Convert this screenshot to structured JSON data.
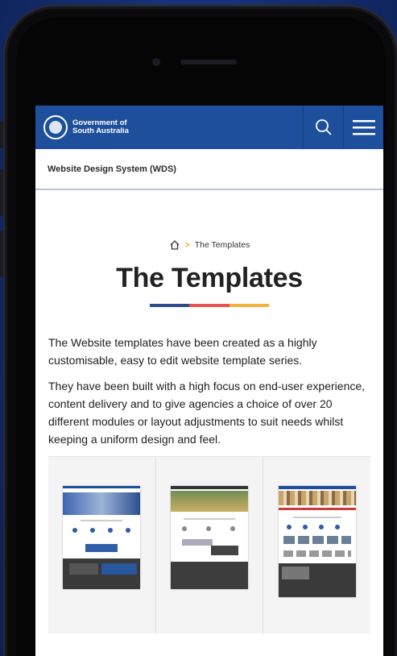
{
  "header": {
    "org_line1": "Government of",
    "org_line2": "South Australia",
    "search_icon": "search-icon",
    "menu_icon": "hamburger-menu-icon"
  },
  "subnav": {
    "site_name": "Website Design System (WDS)"
  },
  "breadcrumb": {
    "home_icon": "home-icon",
    "separator": ">",
    "current": "The Templates"
  },
  "page": {
    "title": "The Templates",
    "paragraph1": "The Website templates have been created as a highly customisable, easy to edit website template series.",
    "paragraph2": "They have been built with a high focus on end-user experience, content delivery and to give agencies a choice of over 20 different modules or layout adjustments to suit needs whilst keeping a uniform design and feel."
  },
  "colors": {
    "header_blue": "#1d4f9c",
    "divider": [
      "#2e4a8c",
      "#e8514f",
      "#f3b13d"
    ]
  },
  "templates": [
    {
      "name": "template-preview-1"
    },
    {
      "name": "template-preview-2"
    },
    {
      "name": "template-preview-3"
    }
  ]
}
